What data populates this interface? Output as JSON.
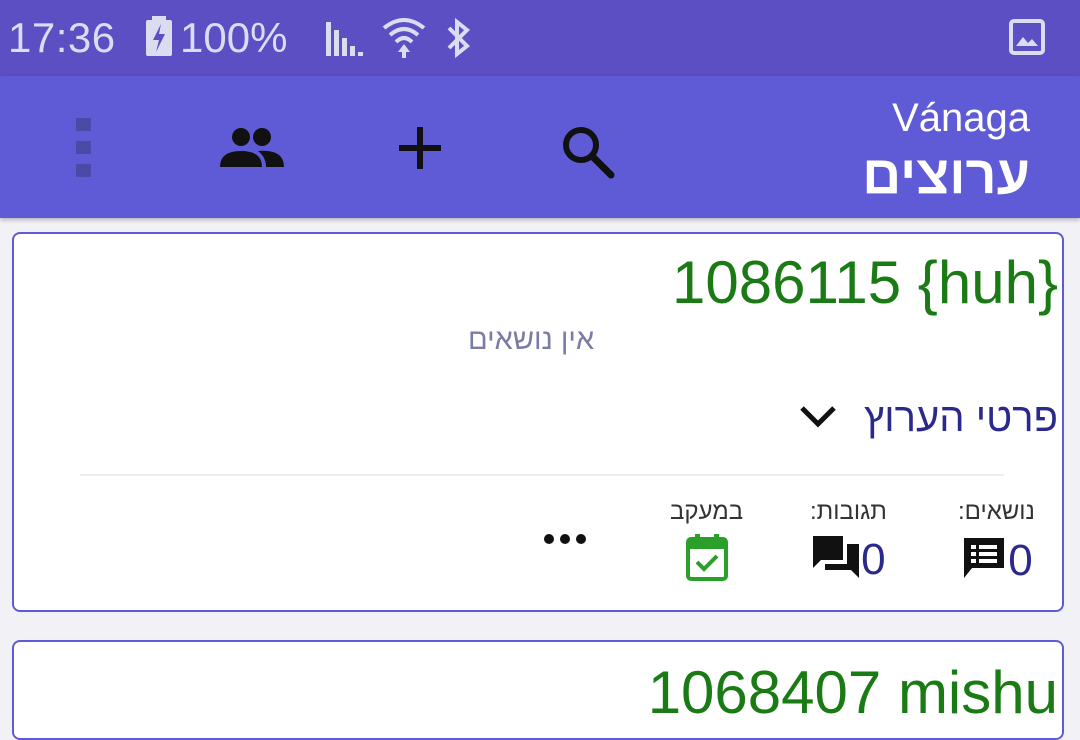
{
  "status_bar": {
    "time": "17:36",
    "battery": "100%",
    "icons": [
      "battery-charging-icon",
      "signal-icon",
      "wifi-icon",
      "bluetooth-icon",
      "image-icon"
    ]
  },
  "app_bar": {
    "subtitle": "Vánaga",
    "title": "ערוצים",
    "actions": [
      "search-icon",
      "add-icon",
      "people-icon",
      "more-vert-icon"
    ]
  },
  "channels": [
    {
      "title": "1086115 {huh}",
      "no_topics": "אין נושאים",
      "details_label": "פרטי הערוץ",
      "stats": {
        "topics_label": "נושאים:",
        "topics_value": "0",
        "replies_label": "תגובות:",
        "replies_value": "0",
        "tracking_label": "במעקב"
      }
    },
    {
      "title": "1068407 mishu"
    }
  ],
  "colors": {
    "status_bar": "#5b4fc3",
    "app_bar": "#5f5bd6",
    "channel_title": "#1a7a14",
    "accent_text": "#2b2a8c",
    "tracking_icon": "#2aa02a"
  }
}
